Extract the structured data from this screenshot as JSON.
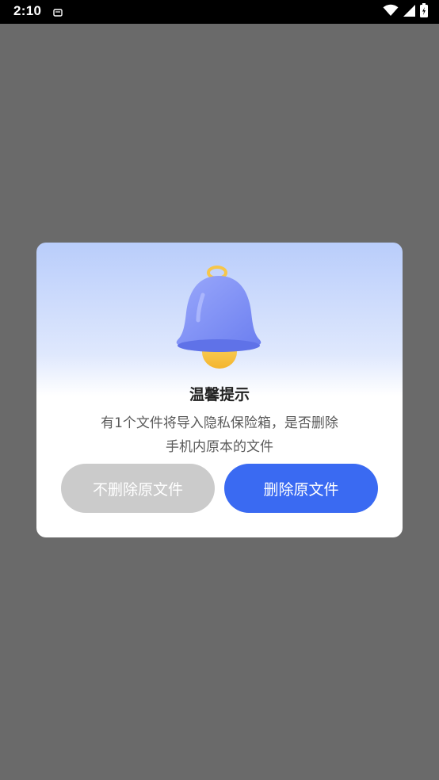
{
  "status_bar": {
    "time": "2:10",
    "icons": [
      "notification-icon",
      "wifi-icon",
      "signal-icon",
      "battery-icon"
    ]
  },
  "dialog": {
    "icon": "bell-icon",
    "title": "温馨提示",
    "message_line1": "有1个文件将导入隐私保险箱，是否删除",
    "message_line2": "手机内原本的文件",
    "keep_button_label": "不删除原文件",
    "delete_button_label": "删除原文件"
  },
  "colors": {
    "overlay": "#6a6a6a",
    "primary_button": "#3a6af2",
    "secondary_button": "#cbcbcb",
    "bell_body": "#8393f5",
    "bell_clapper": "#f8c84a"
  }
}
